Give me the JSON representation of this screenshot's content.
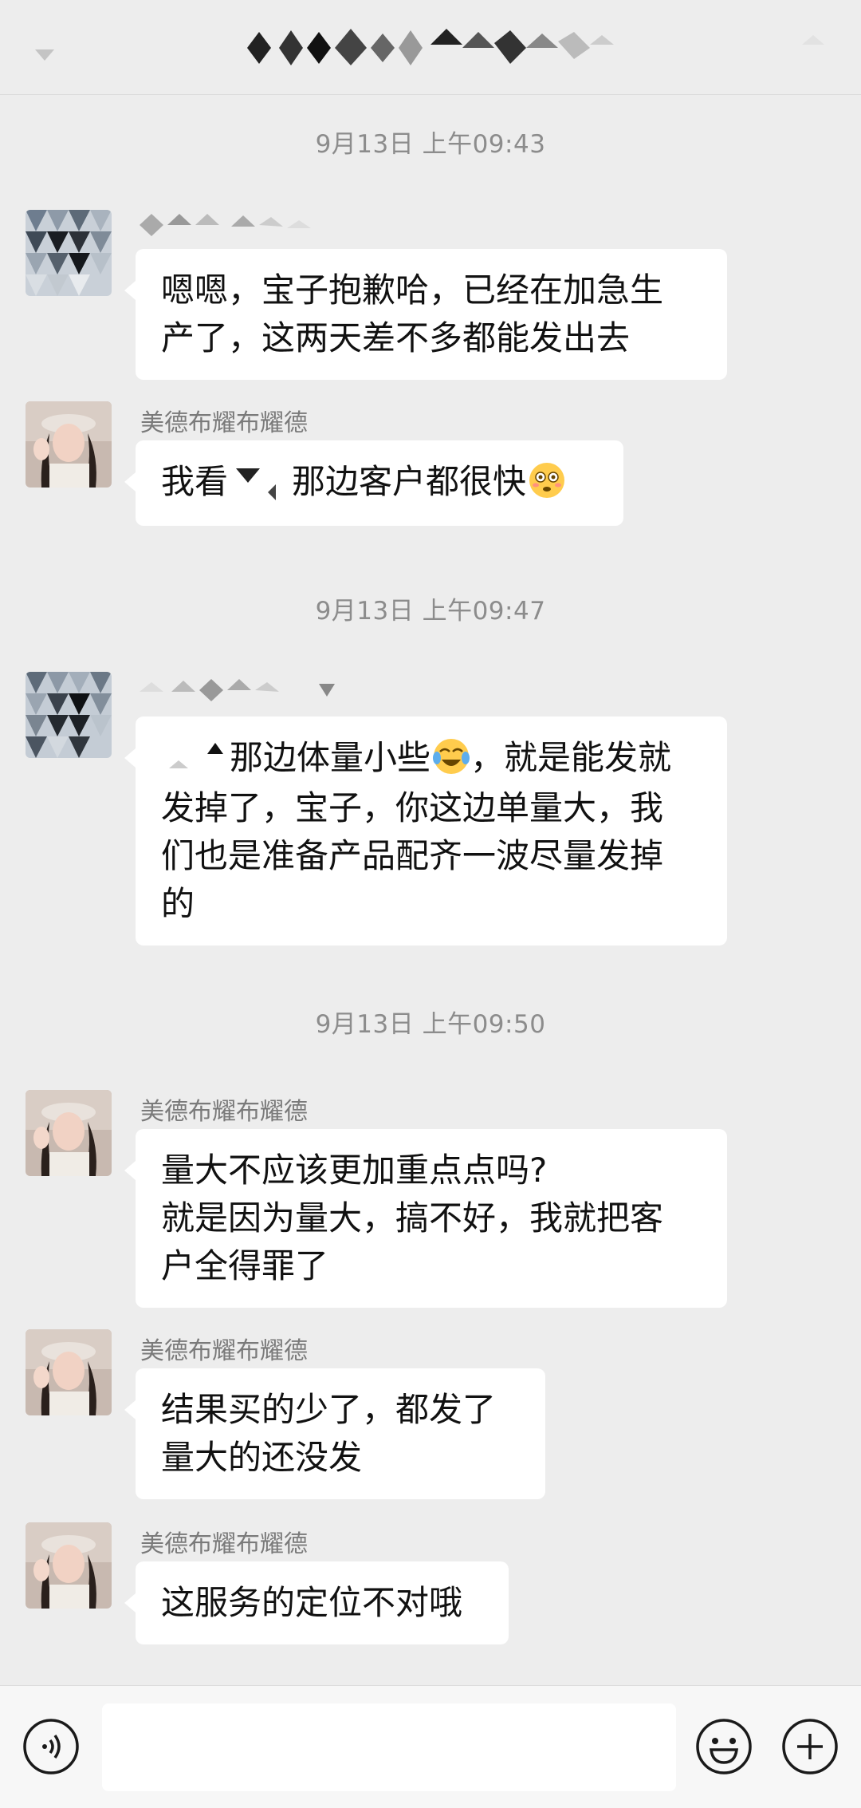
{
  "header": {
    "title_obscured": true,
    "back_icon": "chevron-down-icon",
    "more_icon": "more-icon"
  },
  "messages": [
    {
      "type": "time",
      "text": "9月13日 上午09:43"
    },
    {
      "type": "msg",
      "side": "left",
      "sender": "",
      "sender_obscured": true,
      "avatar": "mosaic",
      "lines": [
        "嗯嗯，宝子抱歉哈，已经在加急生",
        "产了，这两天差不多都能发出去"
      ]
    },
    {
      "type": "msg",
      "side": "left",
      "sender": "美德布耀布耀德",
      "avatar": "photo",
      "lines": [
        "我看",
        "那边客户都很快"
      ],
      "emoji": "flushed-face"
    },
    {
      "type": "time",
      "text": "9月13日 上午09:47"
    },
    {
      "type": "msg",
      "side": "left",
      "sender": "",
      "sender_obscured": true,
      "avatar": "mosaic",
      "lines": [
        "那边体量小些",
        "，就是能发就",
        "发掉了，宝子，你这边单量大，我",
        "们也是准备产品配齐一波尽量发掉",
        "的"
      ],
      "emoji": "crying-laughing-face"
    },
    {
      "type": "time",
      "text": "9月13日 上午09:50"
    },
    {
      "type": "msg",
      "side": "left",
      "sender": "美德布耀布耀德",
      "avatar": "photo",
      "lines": [
        "量大不应该更加重点点吗?",
        "就是因为量大，搞不好，我就把客",
        "户全得罪了"
      ]
    },
    {
      "type": "msg",
      "side": "left",
      "sender": "美德布耀布耀德",
      "avatar": "photo",
      "lines": [
        "结果买的少了，都发了",
        "量大的还没发"
      ]
    },
    {
      "type": "msg",
      "side": "left",
      "sender": "美德布耀布耀德",
      "avatar": "photo",
      "lines": [
        "这服务的定位不对哦"
      ]
    }
  ],
  "input_bar": {
    "voice_icon": "voice-icon",
    "emoji_icon": "emoji-icon",
    "plus_icon": "plus-icon",
    "placeholder": ""
  },
  "colors": {
    "background": "#ededed",
    "bubble": "#ffffff",
    "time_text": "#8c8c8c",
    "sender_text": "#7a7a7a"
  }
}
